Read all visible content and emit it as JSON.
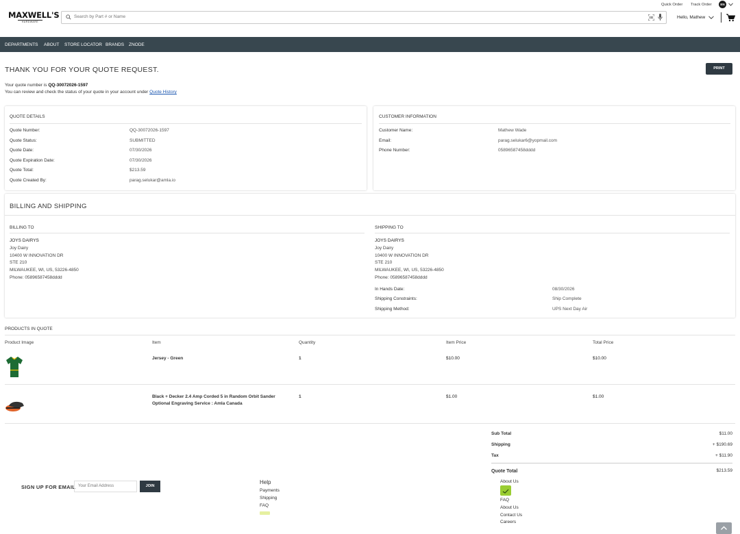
{
  "header": {
    "logo": "MAXWELL'S",
    "logo_sub": "HARDWARE",
    "search_placeholder": "Search by Part # or Name",
    "quick_order": "Quick Order",
    "track_order": "Track Order",
    "language": "EN",
    "greeting": "Hello, Mathew"
  },
  "nav": {
    "items": [
      "DEPARTMENTS",
      "ABOUT",
      "STORE LOCATOR",
      "BRANDS",
      "ZNODE"
    ]
  },
  "confirmation": {
    "title": "THANK YOU FOR YOUR QUOTE REQUEST.",
    "print_label": "PRINT",
    "quote_number_prefix": "Your quote number is ",
    "quote_number": "QQ-30072026-1597",
    "review_text": "You can review and check the status of your quote in your account under ",
    "history_link": "Quote History"
  },
  "quote_details": {
    "title": "QUOTE DETAILS",
    "rows": [
      {
        "label": "Quote Number:",
        "value": "QQ-30072026-1597"
      },
      {
        "label": "Quote Status:",
        "value": "SUBMITTED"
      },
      {
        "label": "Quote Date:",
        "value": "07/30/2026"
      },
      {
        "label": "Quote Expiration Date:",
        "value": "07/30/2026"
      },
      {
        "label": "Quote Total:",
        "value": "$213.59"
      },
      {
        "label": "Quote Created By:",
        "value": "parag.selukar@amla.io"
      }
    ]
  },
  "customer_info": {
    "title": "CUSTOMER INFORMATION",
    "rows": [
      {
        "label": "Customer Name:",
        "value": "Mathew Wade"
      },
      {
        "label": "Email:",
        "value": "parag.selukar6@yopmail.com"
      },
      {
        "label": "Phone Number:",
        "value": "05896587458dddd"
      }
    ]
  },
  "billing_shipping": {
    "title": "BILLING AND SHIPPING",
    "billing": {
      "title": "BILLING TO",
      "lines": [
        "JOYS DAIRYS",
        "Joy Dairy",
        "10400 W INNOVATION DR",
        "STE 210",
        "MILWAUKEE, WI, US, 53226-4850",
        "Phone: 05896587458dddd"
      ]
    },
    "shipping": {
      "title": "SHIPPING TO",
      "lines": [
        "JOYS DAIRYS",
        "Joy Dairy",
        "10400 W INNOVATION DR",
        "STE 210",
        "MILWAUKEE, WI, US, 53226-4850",
        "Phone: 05896587458dddd"
      ],
      "rows": [
        {
          "label": "In Hands Date:",
          "value": "08/30/2026"
        },
        {
          "label": "Shipping Constraints:",
          "value": "Ship Complete"
        },
        {
          "label": "Shipping Method:",
          "value": "UPS Next Day Air"
        }
      ]
    }
  },
  "products": {
    "title": "PRODUCTS IN QUOTE",
    "columns": [
      "Product Image",
      "Item",
      "Quantity",
      "Item Price",
      "Total Price"
    ],
    "rows": [
      {
        "item": "Jersey - Green",
        "extra": "",
        "quantity": "1",
        "item_price": "$10.00",
        "total_price": "$10.00",
        "image_icon": "green-jersey-icon"
      },
      {
        "item": "Black + Decker 2.4 Amp Corded 5 in Random Orbit Sander",
        "extra": "Optional Engraving Service : Amla Canada",
        "quantity": "1",
        "item_price": "$1.00",
        "total_price": "$1.00",
        "image_icon": "orbit-sander-icon"
      }
    ]
  },
  "totals": {
    "sub_total_label": "Sub Total",
    "sub_total": "$11.00",
    "shipping_label": "Shipping",
    "shipping": "+ $190.69",
    "tax_label": "Tax",
    "tax": "+ $11.90",
    "quote_total_label": "Quote Total",
    "quote_total": "$213.59"
  },
  "footer": {
    "signup_label": "SIGN UP FOR EMAIL",
    "email_placeholder": "Your Email Address",
    "join_label": "JOIN",
    "help_title": "Help",
    "help_links": [
      "Payments",
      "Shipping",
      "FAQ"
    ],
    "about_links_top": [
      "About Us"
    ],
    "about_links_bottom": [
      "FAQ",
      "About Us",
      "Contact Us",
      "Careers"
    ]
  },
  "colors": {
    "navbar": "#38474f",
    "button": "#2f3a42",
    "link": "#1a56b0"
  }
}
